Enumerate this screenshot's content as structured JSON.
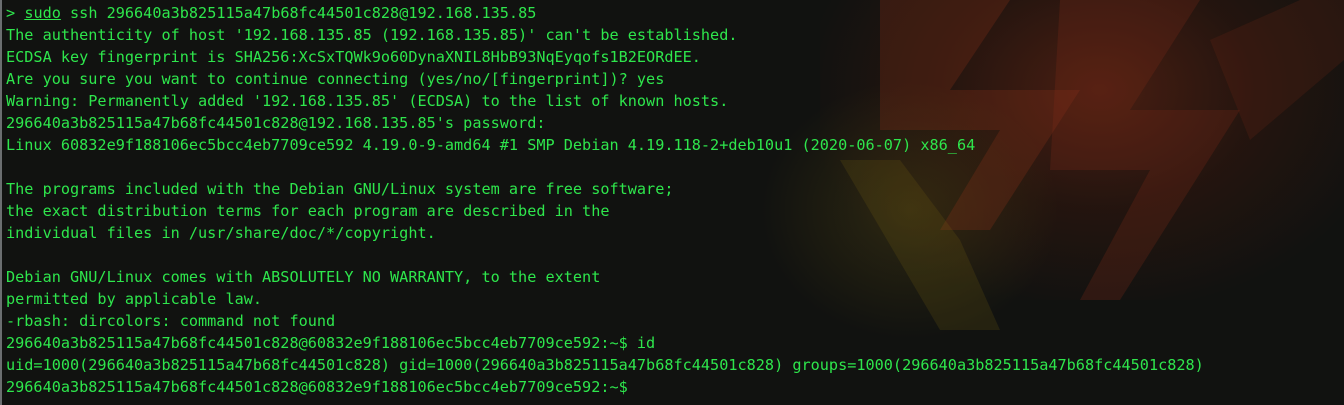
{
  "terminal": {
    "prompt_symbol": ">",
    "command_sudo": "sudo",
    "command_rest": " ssh 296640a3b825115a47b68fc44501c828@192.168.135.85",
    "lines": [
      "The authenticity of host '192.168.135.85 (192.168.135.85)' can't be established.",
      "ECDSA key fingerprint is SHA256:XcSxTQWk9o60DynaXNIL8HbB93NqEyqofs1B2EORdEE.",
      "Are you sure you want to continue connecting (yes/no/[fingerprint])? yes",
      "Warning: Permanently added '192.168.135.85' (ECDSA) to the list of known hosts.",
      "296640a3b825115a47b68fc44501c828@192.168.135.85's password:",
      "Linux 60832e9f188106ec5bcc4eb7709ce592 4.19.0-9-amd64 #1 SMP Debian 4.19.118-2+deb10u1 (2020-06-07) x86_64",
      "",
      "The programs included with the Debian GNU/Linux system are free software;",
      "the exact distribution terms for each program are described in the",
      "individual files in /usr/share/doc/*/copyright.",
      "",
      "Debian GNU/Linux comes with ABSOLUTELY NO WARRANTY, to the extent",
      "permitted by applicable law.",
      "-rbash: dircolors: command not found",
      "296640a3b825115a47b68fc44501c828@60832e9f188106ec5bcc4eb7709ce592:~$ id",
      "uid=1000(296640a3b825115a47b68fc44501c828) gid=1000(296640a3b825115a47b68fc44501c828) groups=1000(296640a3b825115a47b68fc44501c828)",
      "296640a3b825115a47b68fc44501c828@60832e9f188106ec5bcc4eb7709ce592:~$"
    ]
  },
  "colors": {
    "text": "#2ee64c",
    "background": "#111210"
  }
}
